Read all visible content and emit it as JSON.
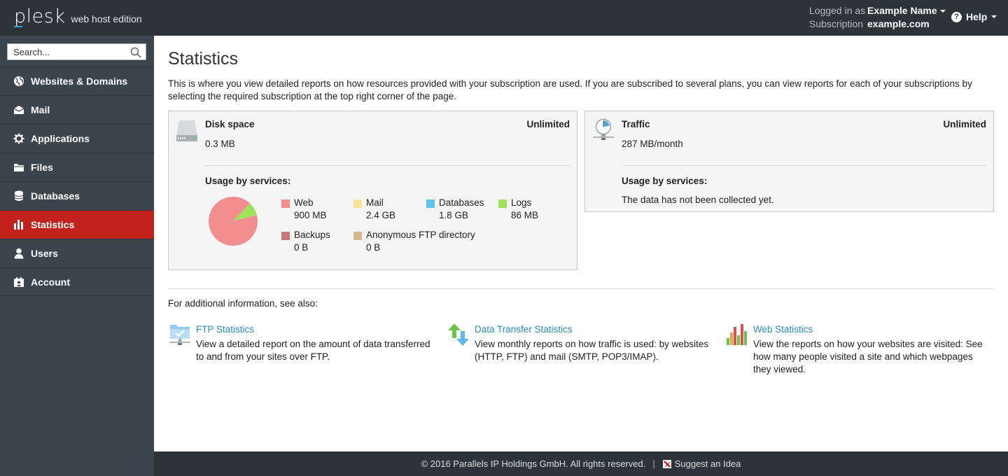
{
  "header": {
    "logo_text": "plesk",
    "edition": "web host edition",
    "logged_in_label": "Logged in as",
    "user_name": "Example Name",
    "subscription_label": "Subscription",
    "subscription_value": "example.com",
    "help_label": "Help"
  },
  "sidebar": {
    "search_placeholder": "Search...",
    "items": [
      {
        "label": "Websites & Domains",
        "icon": "globe-icon"
      },
      {
        "label": "Mail",
        "icon": "mail-icon"
      },
      {
        "label": "Applications",
        "icon": "gear-icon"
      },
      {
        "label": "Files",
        "icon": "folder-icon"
      },
      {
        "label": "Databases",
        "icon": "database-icon"
      },
      {
        "label": "Statistics",
        "icon": "bar-chart-icon",
        "active": true
      },
      {
        "label": "Users",
        "icon": "user-icon"
      },
      {
        "label": "Account",
        "icon": "account-icon"
      }
    ]
  },
  "main": {
    "title": "Statistics",
    "intro": "This is where you view detailed reports on how resources provided with your subscription are used. If you are subscribed to several plans, you can view reports for each of your subscriptions by selecting the required subscription at the top right corner of the page.",
    "disk": {
      "title": "Disk space",
      "limit": "Unlimited",
      "value": "0.3 MB",
      "usage_title": "Usage by services:",
      "services": [
        {
          "name": "Web",
          "value": "900 MB",
          "color": "#f28e8e"
        },
        {
          "name": "Mail",
          "value": "2.4 GB",
          "color": "#fbe39a"
        },
        {
          "name": "Databases",
          "value": "1.8 GB",
          "color": "#5fc3ec"
        },
        {
          "name": "Logs",
          "value": "86 MB",
          "color": "#9ee35a"
        },
        {
          "name": "Backups",
          "value": "0 B",
          "color": "#c87878"
        },
        {
          "name": "Anonymous FTP directory",
          "value": "0 B",
          "color": "#d4b98a"
        }
      ]
    },
    "traffic": {
      "title": "Traffic",
      "limit": "Unlimited",
      "value": "287 MB/month",
      "usage_title": "Usage by services:",
      "no_data": "The data has not been collected yet."
    },
    "see_also": "For additional information, see also:",
    "links": [
      {
        "title": "FTP Statistics",
        "desc": "View a detailed report on the amount of data transferred to and from your sites over FTP.",
        "icon": "ftp-folder-icon"
      },
      {
        "title": "Data Transfer Statistics",
        "desc": "View monthly reports on how traffic is used: by websites (HTTP, FTP) and mail (SMTP, POP3/IMAP).",
        "icon": "transfer-arrows-icon"
      },
      {
        "title": "Web Statistics",
        "desc": "View the reports on how your websites are visited: See how many people visited a site and which webpages they viewed.",
        "icon": "bar-chart-icon"
      }
    ]
  },
  "footer": {
    "copyright": "© 2016 Parallels IP Holdings GmbH. All rights reserved.",
    "separator": "|",
    "suggest": "Suggest an Idea"
  }
}
